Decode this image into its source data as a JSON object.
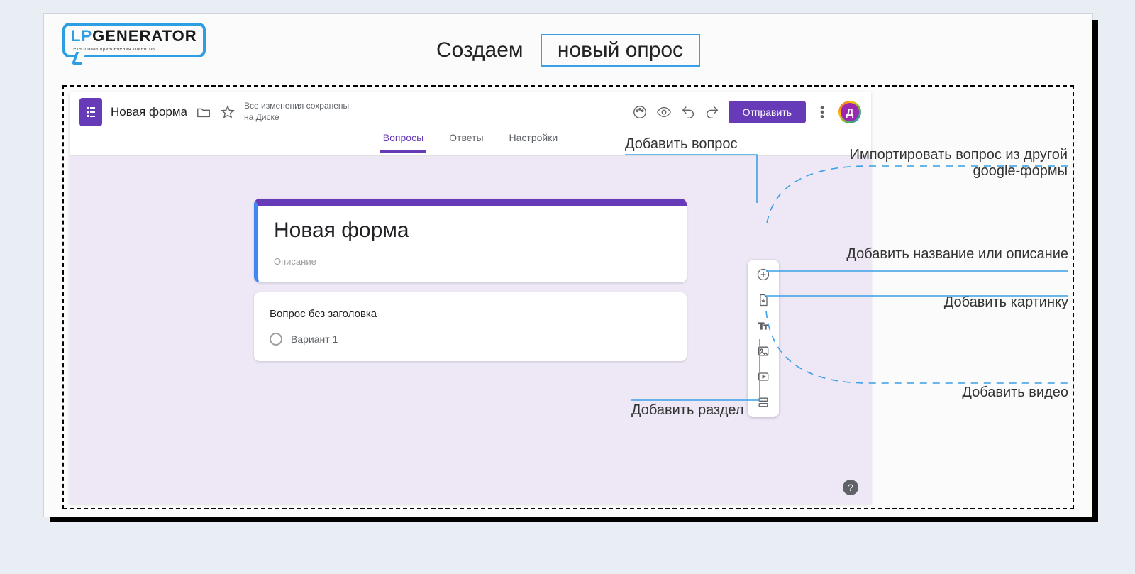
{
  "logo": {
    "main_prefix": "LP",
    "main_rest": "GENERATOR",
    "sub": "технологии привлечения клиентов"
  },
  "page_title": {
    "plain": "Создаем",
    "boxed": "новый опрос"
  },
  "header": {
    "form_name": "Новая форма",
    "save_status": "Все изменения сохранены на Диске",
    "send_label": "Отправить",
    "avatar_letter": "Д"
  },
  "tabs": [
    "Вопросы",
    "Ответы",
    "Настройки"
  ],
  "active_tab_index": 0,
  "form": {
    "title": "Новая форма",
    "description_placeholder": "Описание",
    "question_text": "Вопрос без заголовка",
    "option1": "Вариант 1"
  },
  "annotations": {
    "add_question": "Добавить вопрос",
    "import_question_l1": "Импортировать вопрос из другой",
    "import_question_l2": "google-формы",
    "add_title_desc": "Добавить название или описание",
    "add_image": "Добавить картинку",
    "add_video": "Добавить видео",
    "add_section": "Добавить раздел"
  },
  "help_symbol": "?"
}
